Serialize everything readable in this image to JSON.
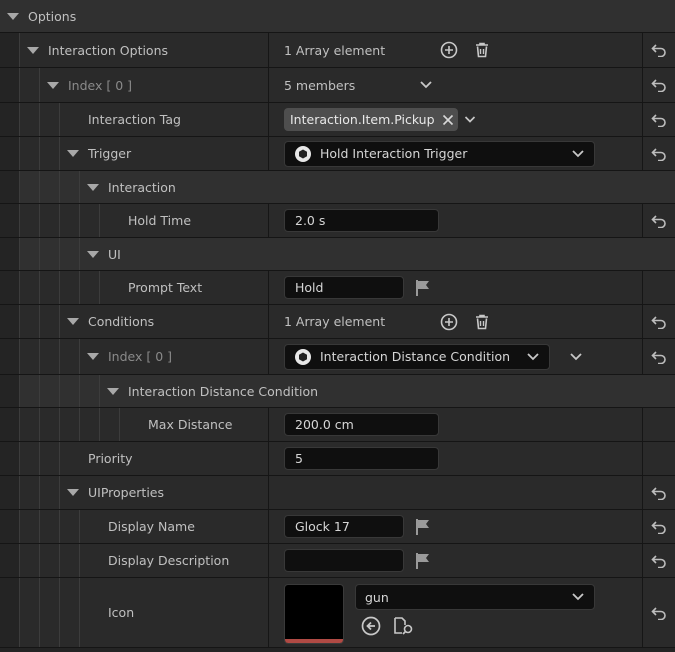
{
  "category": {
    "label": "Options"
  },
  "interaction_options": {
    "label": "Interaction Options",
    "value": "1 Array element"
  },
  "index0": {
    "label": "Index [ 0 ]",
    "value": "5 members"
  },
  "interaction_tag": {
    "label": "Interaction Tag",
    "value": "Interaction.Item.Pickup"
  },
  "trigger": {
    "label": "Trigger",
    "value": "Hold Interaction Trigger"
  },
  "interaction": {
    "label": "Interaction"
  },
  "hold_time": {
    "label": "Hold Time",
    "value": "2.0 s"
  },
  "ui": {
    "label": "UI"
  },
  "prompt_text": {
    "label": "Prompt Text",
    "value": "Hold"
  },
  "conditions": {
    "label": "Conditions",
    "value": "1 Array element"
  },
  "cond_index": {
    "label": "Index [ 0 ]",
    "value": "Interaction Distance Condition"
  },
  "distance_condition": {
    "label": "Interaction Distance Condition"
  },
  "max_distance": {
    "label": "Max Distance",
    "value": "200.0 cm"
  },
  "priority": {
    "label": "Priority",
    "value": "5"
  },
  "ui_properties": {
    "label": "UIProperties"
  },
  "display_name": {
    "label": "Display Name",
    "value": "Glock 17"
  },
  "display_description": {
    "label": "Display Description",
    "value": ""
  },
  "icon": {
    "label": "Icon",
    "value": "gun"
  },
  "colors": {
    "accent_bar": "#b04a44",
    "panel": "#2a2a2a",
    "field": "#0f0f0f"
  }
}
